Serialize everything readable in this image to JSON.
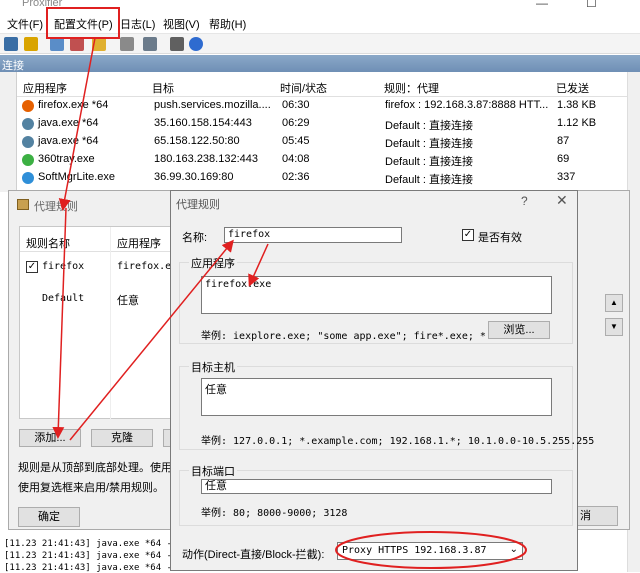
{
  "window": {
    "title": "Proxifier"
  },
  "menu": {
    "items": [
      "文件(F)",
      "配置文件(P)",
      "日志(L)",
      "视图(V)",
      "帮助(H)"
    ]
  },
  "connections": {
    "header": "连接",
    "columns": [
      "应用程序",
      "目标",
      "时间/状态",
      "规则：代理",
      "已发送"
    ],
    "rows": [
      {
        "app": "firefox.exe *64",
        "target": "push.services.mozilla....",
        "time": "06:30",
        "rule": "firefox : 192.168.3.87:8888 HTT...",
        "sent": "1.38 KB",
        "icon_color": "#e66000"
      },
      {
        "app": "java.exe *64",
        "target": "35.160.158.154:443",
        "time": "06:29",
        "rule": "Default : 直接连接",
        "sent": "1.12 KB",
        "icon_color": "#5382a1"
      },
      {
        "app": "java.exe *64",
        "target": "65.158.122.50:80",
        "time": "05:45",
        "rule": "Default : 直接连接",
        "sent": "87",
        "icon_color": "#5382a1"
      },
      {
        "app": "360tray.exe",
        "target": "180.163.238.132:443",
        "time": "04:08",
        "rule": "Default : 直接连接",
        "sent": "69",
        "icon_color": "#3cb043"
      },
      {
        "app": "SoftMgrLite.exe",
        "target": "36.99.30.169:80",
        "time": "02:36",
        "rule": "Default : 直接连接",
        "sent": "337",
        "icon_color": "#2f8fd8"
      }
    ]
  },
  "rules_window": {
    "title": "代理规则",
    "columns": [
      "规则名称",
      "应用程序"
    ],
    "rules": [
      {
        "name": "firefox",
        "app": "firefox.exe",
        "checked": true
      },
      {
        "name": "Default",
        "app": "任意"
      }
    ],
    "add_button": "添加...",
    "clone_button": "克隆",
    "desc_line1": "规则是从顶部到底部处理。使用右",
    "desc_line2": "使用复选框来启用/禁用规则。",
    "ok_button": "确定",
    "cancel_partial": "消"
  },
  "rule_dialog": {
    "title": "代理规则",
    "help": "?",
    "close": "✕",
    "name_label": "名称:",
    "name_value": "firefox",
    "enabled_label": "是否有效",
    "enabled": true,
    "apps_label": "应用程序",
    "apps_value": "firefox.exe",
    "apps_example": "举例: iexplore.exe; \"some app.exe\"; fire*.exe; *.bin",
    "browse_button": "浏览...",
    "hosts_label": "目标主机",
    "hosts_value": "任意",
    "hosts_example": "举例: 127.0.0.1; *.example.com; 192.168.1.*; 10.1.0.0-10.5.255.255",
    "ports_label": "目标端口",
    "ports_value": "任意",
    "ports_example": "举例: 80; 8000-9000; 3128",
    "action_label": "动作(Direct-直接/Block-拦截):",
    "action_value": "Proxy HTTPS 192.168.3.87"
  },
  "log": {
    "lines": [
      "[11.23 21:41:43] java.exe *64 - 1",
      "[11.23 21:41:43] java.exe *64 - 1",
      "[11.23 21:41:43] java.exe *64 - 1"
    ]
  },
  "annotation_color": "#e02020"
}
